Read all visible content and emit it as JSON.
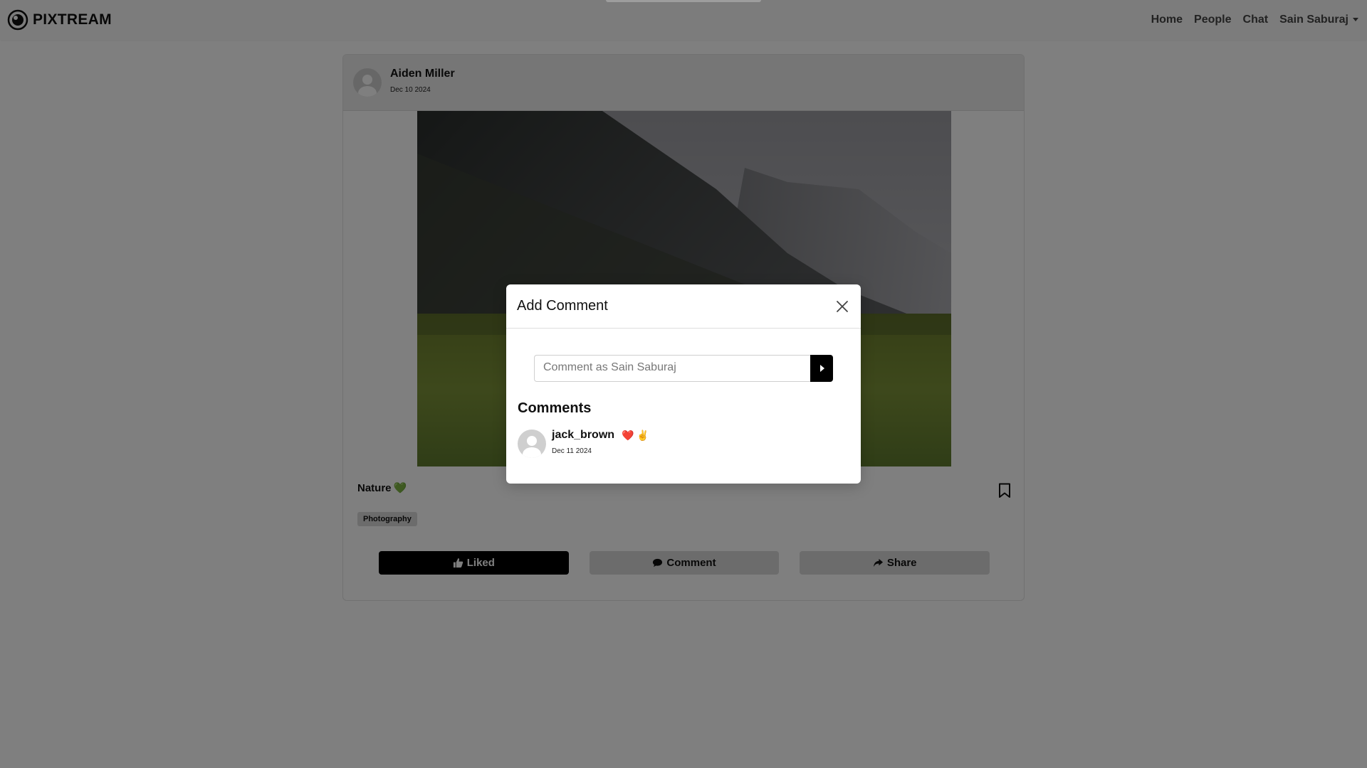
{
  "navbar": {
    "brand": "PIXTREAM",
    "links": [
      "Home",
      "People",
      "Chat"
    ],
    "user_menu": "Sain Saburaj"
  },
  "post": {
    "author": "Aiden Miller",
    "date": "Dec 10 2024",
    "caption": "Nature",
    "caption_emoji": "💚",
    "tag": "Photography",
    "actions": {
      "liked_label": "Liked",
      "comment_label": "Comment",
      "share_label": "Share"
    }
  },
  "modal": {
    "title": "Add Comment",
    "input_placeholder": "Comment as Sain Saburaj",
    "input_value": "",
    "comments_heading": "Comments",
    "comments": [
      {
        "user": "jack_brown",
        "text": "❤️ ✌️",
        "date": "Dec 11 2024"
      }
    ]
  },
  "colors": {
    "accent": "#000000",
    "heart": "#0a8a4a",
    "backdrop": "rgba(0,0,0,0.5)"
  }
}
